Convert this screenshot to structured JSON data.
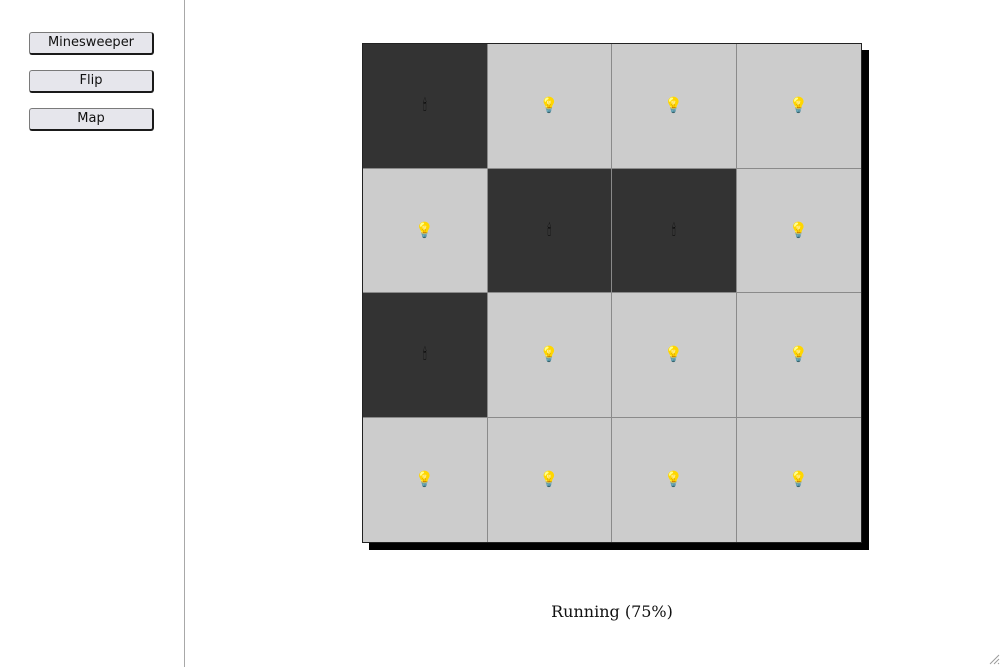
{
  "sidebar": {
    "buttons": [
      {
        "label": "Minesweeper"
      },
      {
        "label": "Flip"
      },
      {
        "label": "Map"
      }
    ]
  },
  "board": {
    "rows": 4,
    "cols": 4,
    "cells": [
      [
        "off",
        "on",
        "on",
        "on"
      ],
      [
        "on",
        "off",
        "off",
        "on"
      ],
      [
        "off",
        "on",
        "on",
        "on"
      ],
      [
        "on",
        "on",
        "on",
        "on"
      ]
    ],
    "icons": {
      "on": "💡",
      "off": "🕯"
    }
  },
  "status": {
    "text": "Running (75%)"
  }
}
